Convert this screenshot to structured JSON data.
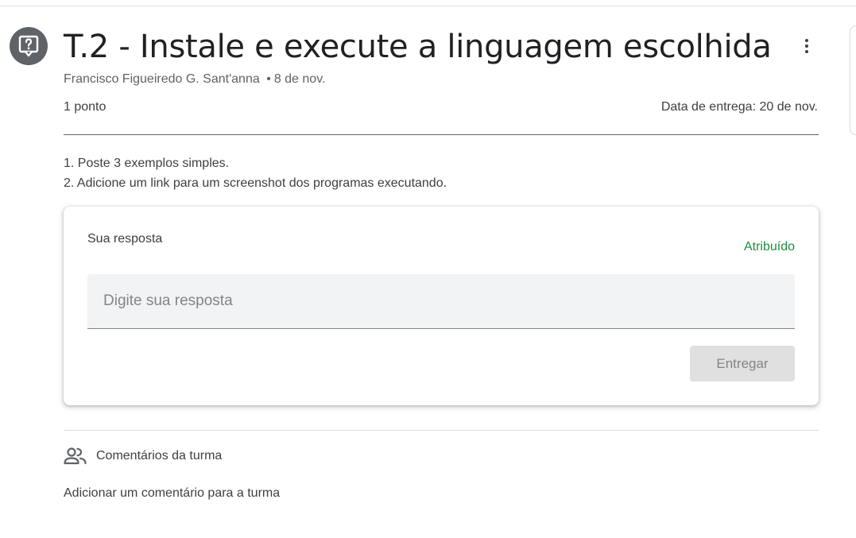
{
  "assignment": {
    "icon": "assignment-question-icon",
    "title": "T.2 - Instale e execute a linguagem escolhida",
    "author": "Francisco Figueiredo G. Sant'anna",
    "separator": "•",
    "posted_date": "8 de nov.",
    "points": "1 ponto",
    "due_date": "Data de entrega: 20 de nov.",
    "instructions": [
      "1. Poste 3 exemplos simples.",
      "2. Adicione um link para um screenshot dos programas executando."
    ]
  },
  "your_work": {
    "title": "Sua resposta",
    "status": "Atribuído",
    "status_color": "#1e8e3e",
    "answer_placeholder": "Digite sua resposta",
    "submit_label": "Entregar"
  },
  "class_comments": {
    "icon": "people-icon",
    "label": "Comentários da turma",
    "add_label": "Adicionar um comentário para a turma"
  }
}
